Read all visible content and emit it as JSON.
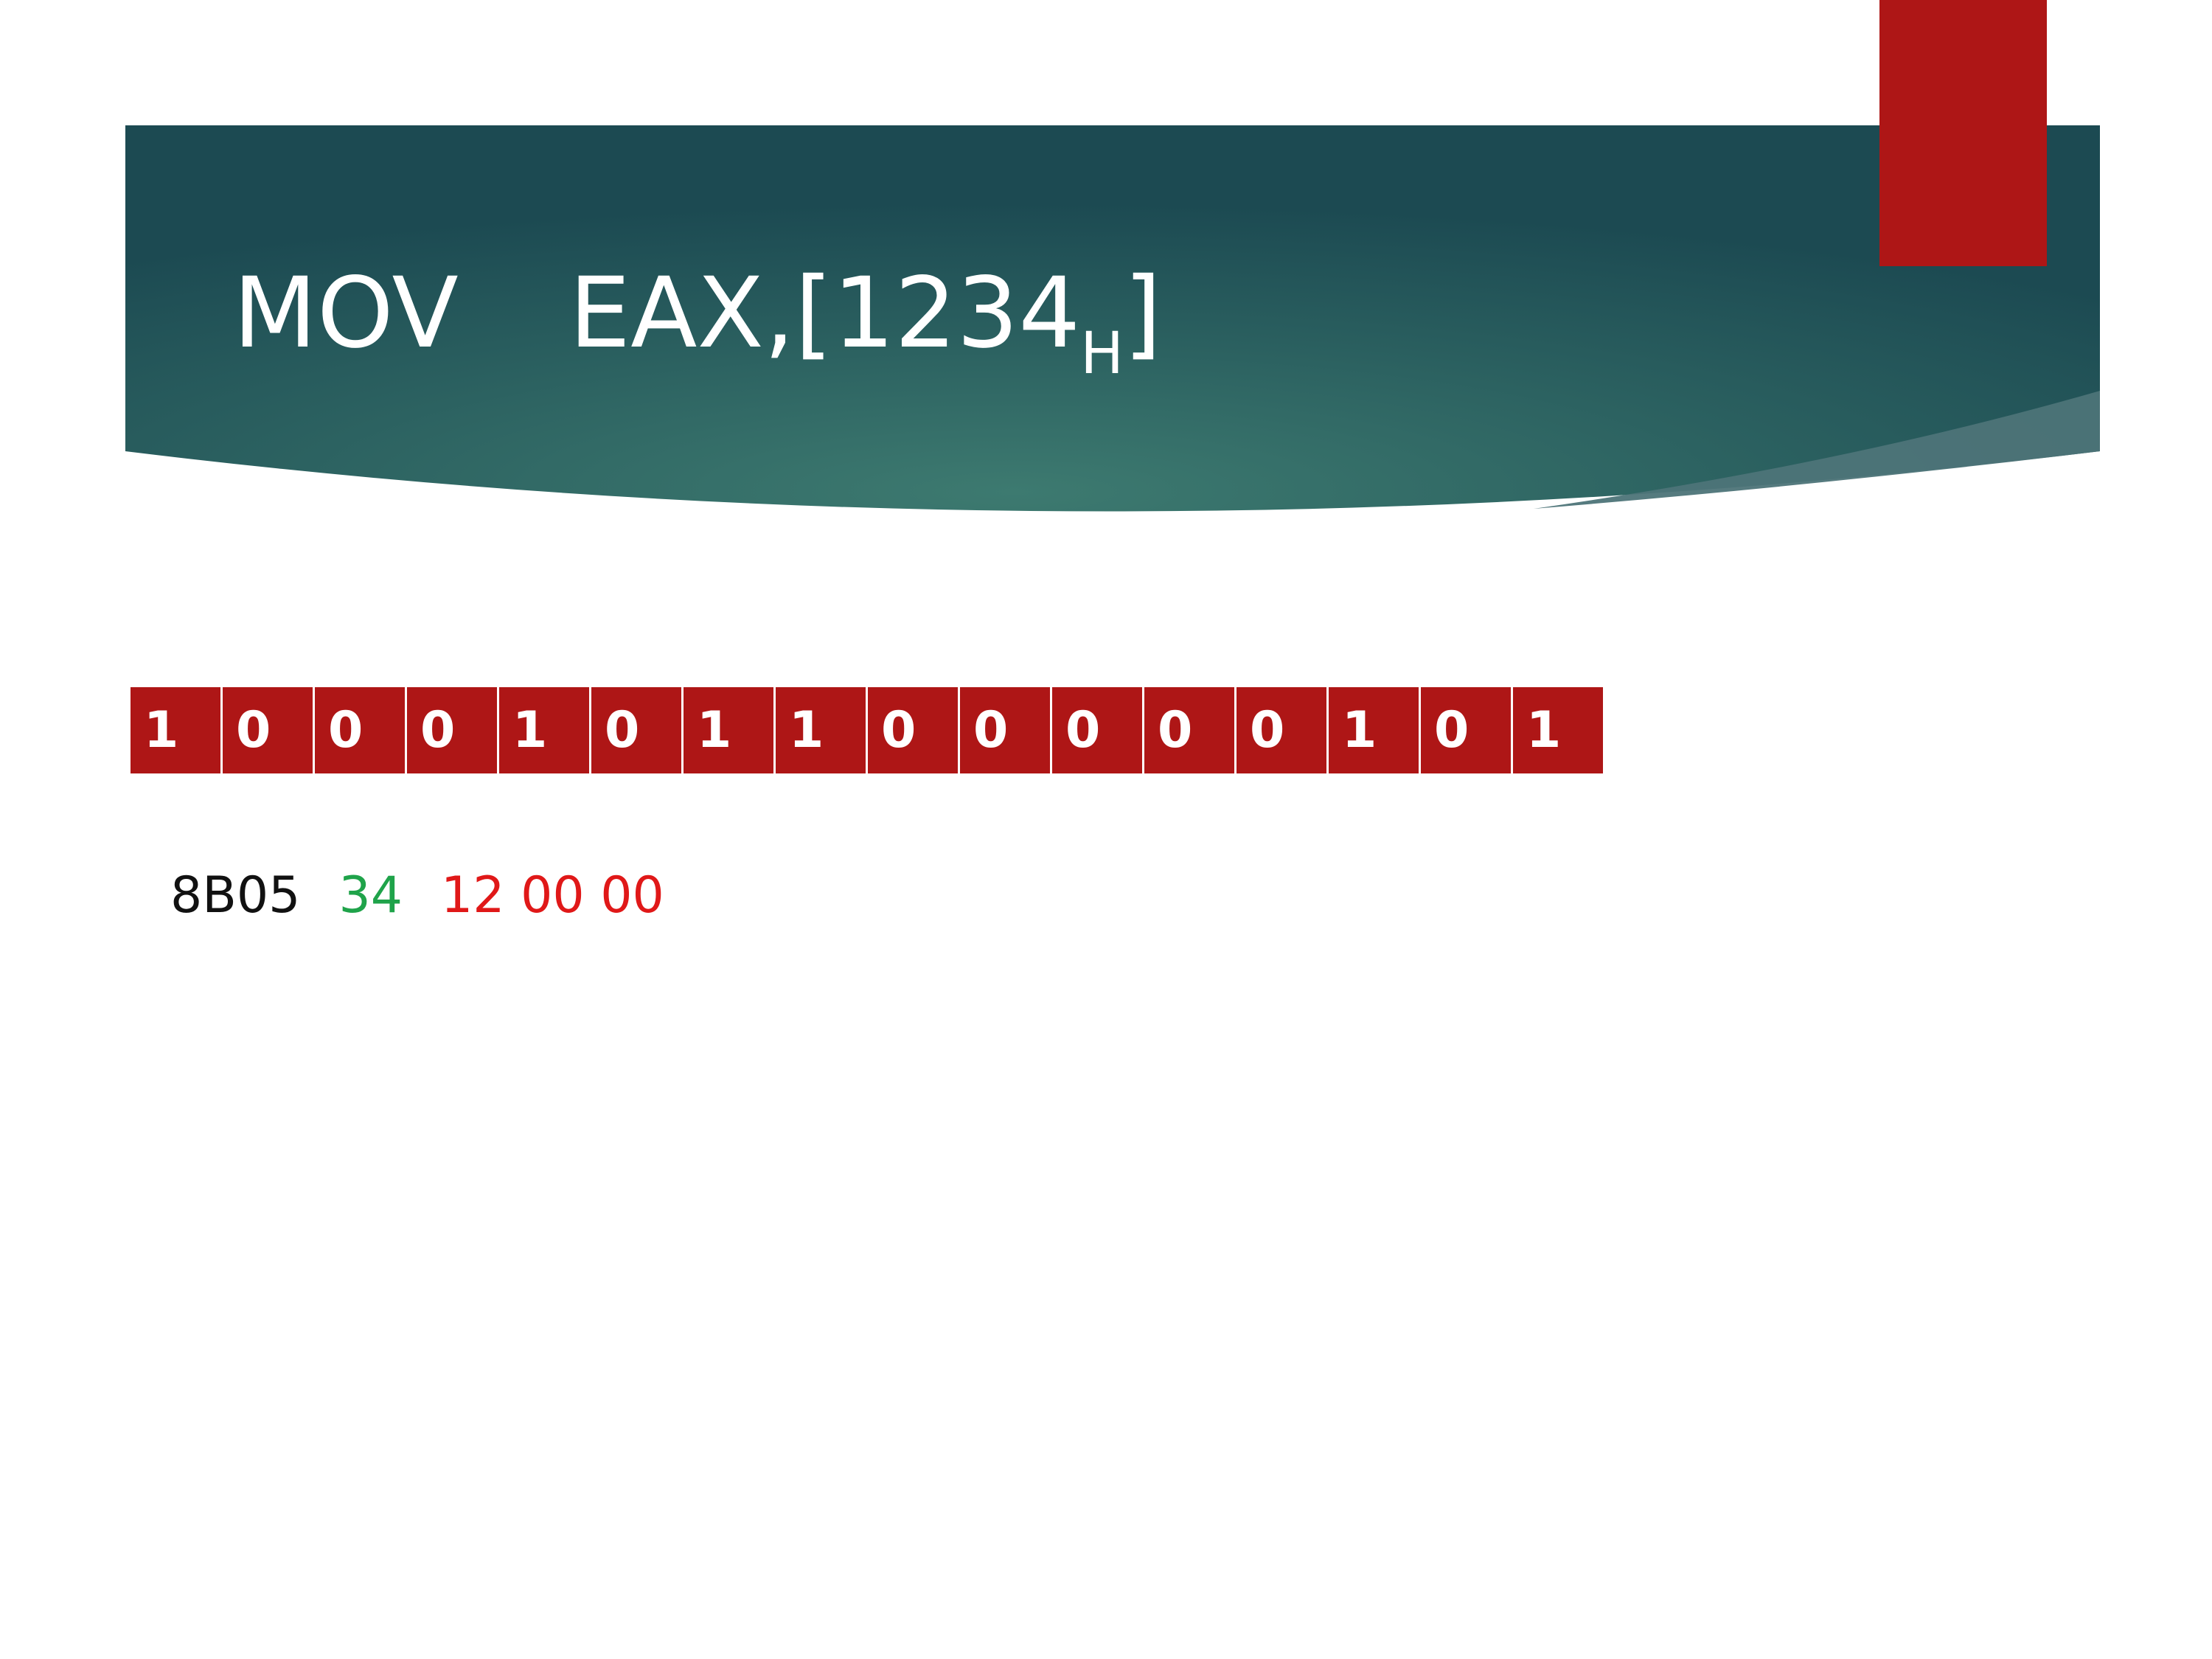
{
  "title": {
    "mnemonic": "MOV",
    "operands": "EAX,[1234",
    "subscript": "H",
    "close": "]"
  },
  "colors": {
    "banner_dark": "#1c4a52",
    "banner_light": "#3d7a70",
    "accent_red": "#ae1616",
    "bits_red": "#ae1616",
    "opcode_text": "#111111",
    "modrm_text": "#1fa34a",
    "address_text": "#e01818"
  },
  "bits": [
    "1",
    "0",
    "0",
    "0",
    "1",
    "0",
    "1",
    "1",
    "0",
    "0",
    "0",
    "0",
    "0",
    "1",
    "0",
    "1"
  ],
  "encoding": {
    "opcode": "8B05",
    "modrm": "34",
    "address": "12 00 00"
  }
}
